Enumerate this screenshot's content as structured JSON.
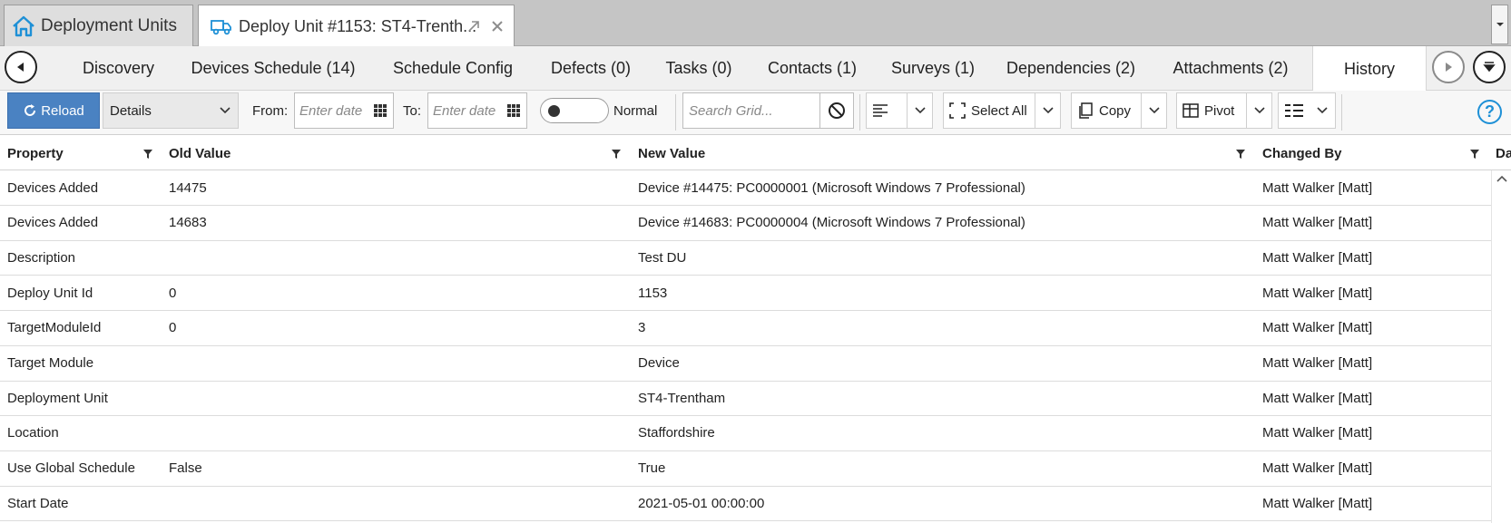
{
  "doc_tabs": {
    "home_label": "Deployment Units",
    "active_label": "Deploy Unit #1153: ST4-Trenth..."
  },
  "sub_tabs": [
    {
      "label": "Discovery"
    },
    {
      "label": "Devices Schedule (14)"
    },
    {
      "label": "Schedule Config"
    },
    {
      "label": "Defects (0)"
    },
    {
      "label": "Tasks (0)"
    },
    {
      "label": "Contacts (1)"
    },
    {
      "label": "Surveys (1)"
    },
    {
      "label": "Dependencies (2)"
    },
    {
      "label": "Attachments (2)"
    },
    {
      "label": "History",
      "active": true
    }
  ],
  "toolbar": {
    "reload_label": "Reload",
    "view_select_value": "Details",
    "from_label": "From:",
    "from_placeholder": "Enter date",
    "to_label": "To:",
    "to_placeholder": "Enter date",
    "toggle_label": "Normal",
    "search_placeholder": "Search Grid...",
    "select_all_label": "Select All",
    "copy_label": "Copy",
    "pivot_label": "Pivot",
    "help_label": "?"
  },
  "grid": {
    "columns": [
      "Property",
      "Old Value",
      "New Value",
      "Changed By",
      "Da"
    ],
    "rows": [
      [
        "Devices Added",
        "14475",
        "Device #14475: PC0000001 (Microsoft Windows 7 Professional)",
        "Matt Walker [Matt]"
      ],
      [
        "Devices Added",
        "14683",
        "Device #14683: PC0000004 (Microsoft Windows 7 Professional)",
        "Matt Walker [Matt]"
      ],
      [
        "Description",
        "",
        "Test DU",
        "Matt Walker [Matt]"
      ],
      [
        "Deploy Unit Id",
        "0",
        "1153",
        "Matt Walker [Matt]"
      ],
      [
        "TargetModuleId",
        "0",
        "3",
        "Matt Walker [Matt]"
      ],
      [
        "Target Module",
        "",
        "Device",
        "Matt Walker [Matt]"
      ],
      [
        "Deployment Unit",
        "",
        "ST4-Trentham",
        "Matt Walker [Matt]"
      ],
      [
        "Location",
        "",
        "Staffordshire",
        "Matt Walker [Matt]"
      ],
      [
        "Use Global Schedule",
        "False",
        "True",
        "Matt Walker [Matt]"
      ],
      [
        "Start Date",
        "",
        "2021-05-01 00:00:00",
        "Matt Walker [Matt]"
      ]
    ]
  },
  "colors": {
    "accent": "#4a82c2",
    "help": "#1e90d6",
    "tab_icon": "#1e90d6"
  }
}
